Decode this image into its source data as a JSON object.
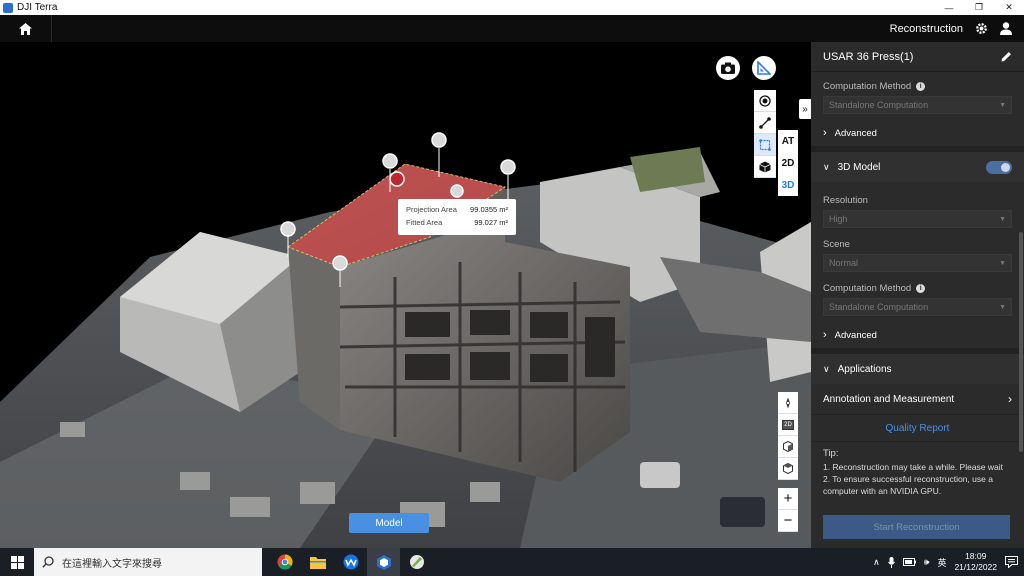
{
  "window": {
    "title": "DJI Terra",
    "minimize": "—",
    "restore": "❐",
    "close": "✕"
  },
  "appbar": {
    "mode": "Reconstruction"
  },
  "viewport": {
    "measure": {
      "projection_label": "Projection Area",
      "projection_value": "99.0355 m²",
      "fitted_label": "Fitted Area",
      "fitted_value": "99.027 m²"
    },
    "dimensions": [
      "AT",
      "2D",
      "3D"
    ],
    "active_dimension": "3D",
    "view_tools": [
      "2D"
    ],
    "zoom_in": "+",
    "zoom_out": "−",
    "model_button": "Model",
    "collapse": "»"
  },
  "panel": {
    "title": "USAR 36 Press(1)",
    "at": {
      "computation_label": "Computation Method",
      "computation_value": "Standalone Computation",
      "advanced": "Advanced"
    },
    "model3d": {
      "title": "3D Model",
      "enabled": true,
      "resolution_label": "Resolution",
      "resolution_value": "High",
      "scene_label": "Scene",
      "scene_value": "Normal",
      "computation_label": "Computation Method",
      "computation_value": "Standalone Computation",
      "advanced": "Advanced"
    },
    "applications": {
      "title": "Applications",
      "annotation": "Annotation and Measurement",
      "quality_report": "Quality Report"
    },
    "tip": {
      "title": "Tip:",
      "line1": "1. Reconstruction may take a while. Please wait",
      "line2": "2. To ensure successful reconstruction, use a computer with an NVIDIA GPU."
    },
    "start_button": "Start Reconstruction"
  },
  "taskbar": {
    "search_placeholder": "在這裡輸入文字來搜尋",
    "ime": "英",
    "time": "18:09",
    "date": "21/12/2022"
  },
  "colors": {
    "accent": "#4a90e2",
    "roof": "#c74a4a",
    "panel": "#2b2b2b"
  }
}
